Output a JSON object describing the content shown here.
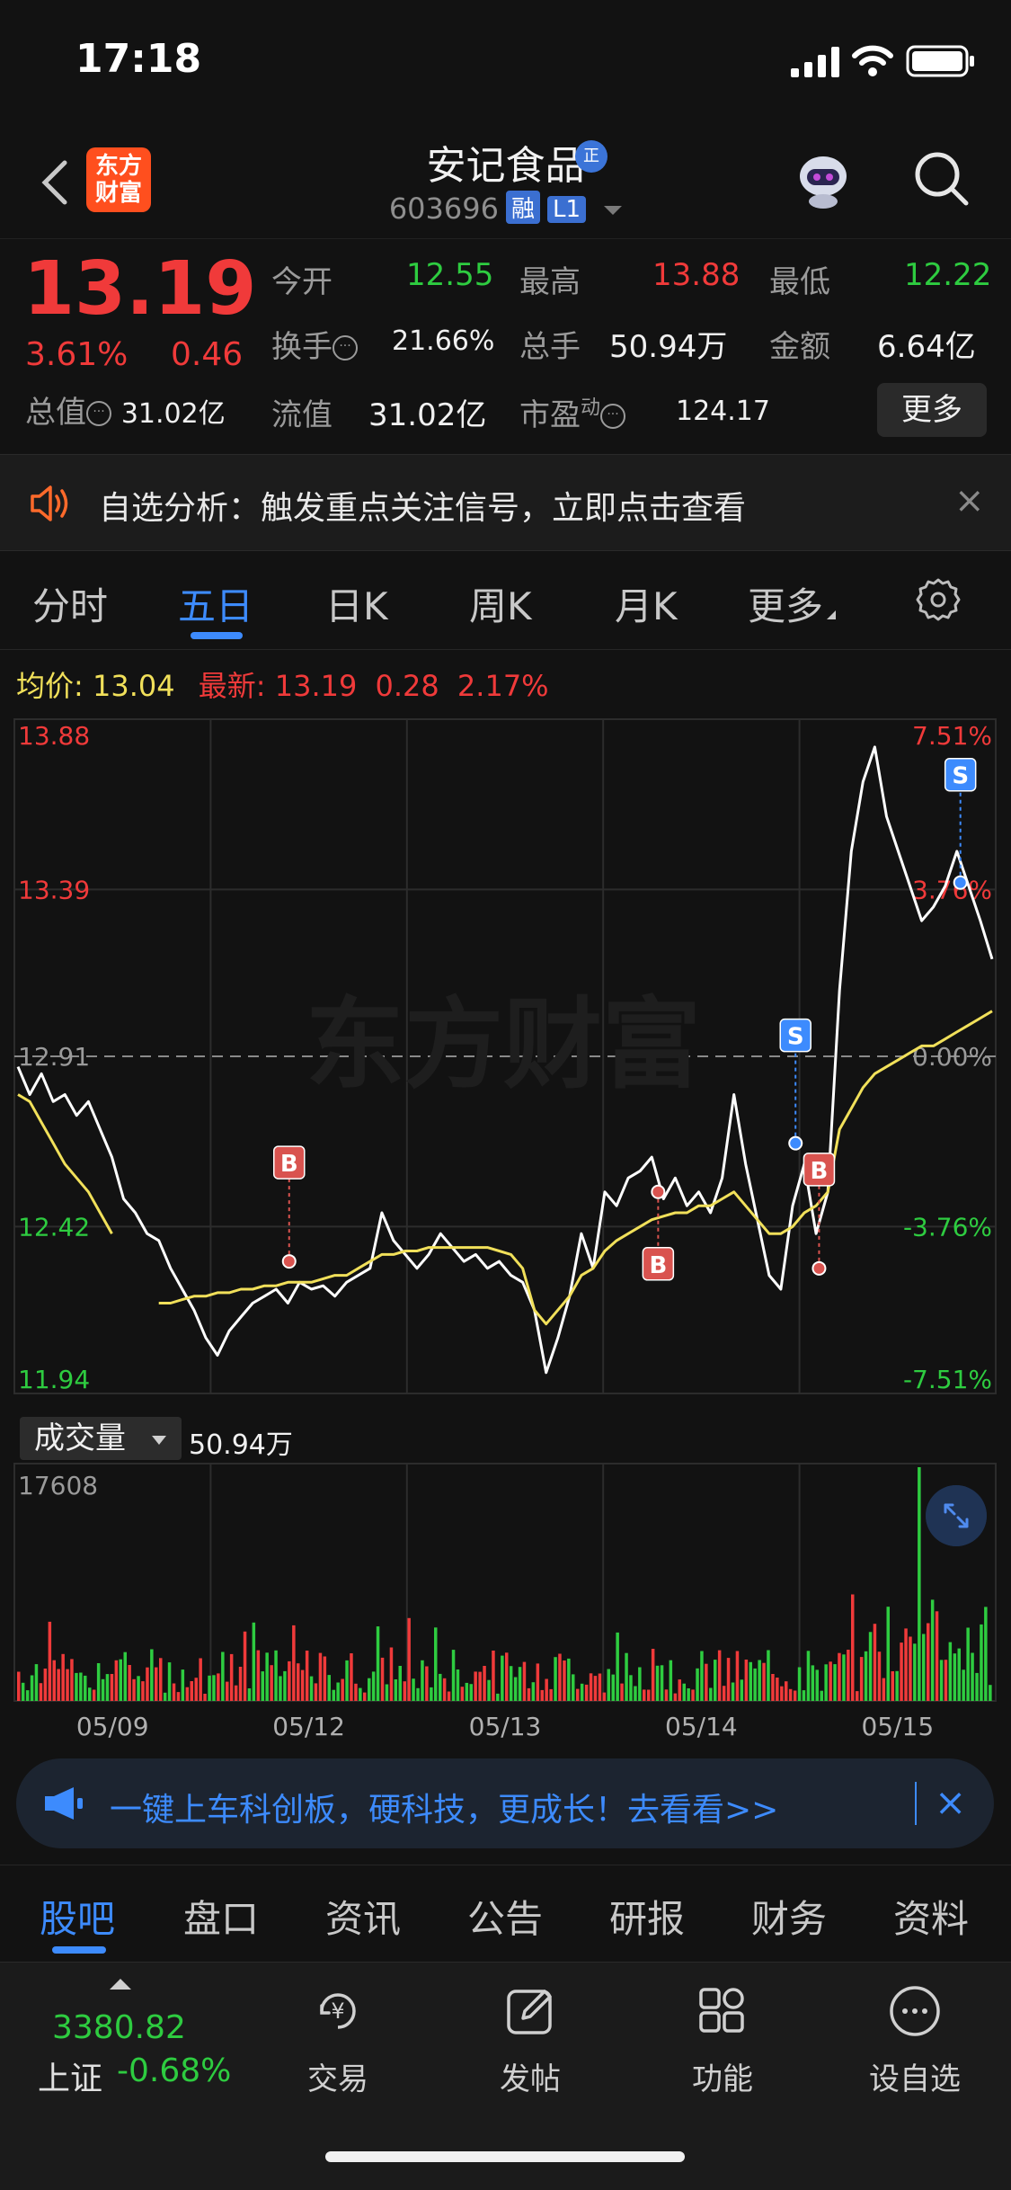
{
  "status_bar": {
    "time": "17:18"
  },
  "header": {
    "logo_text": "东方财富",
    "stock_name": "安记食品",
    "verified_badge": "正",
    "stock_code": "603696",
    "tags": [
      "融",
      "L1"
    ]
  },
  "quote": {
    "last_price": "13.19",
    "pct_change": "3.61%",
    "abs_change": "0.46",
    "open_label": "今开",
    "open_value": "12.55",
    "high_label": "最高",
    "high_value": "13.88",
    "low_label": "最低",
    "low_value": "12.22",
    "turnover_rate_label": "换手",
    "turnover_rate_value": "21.66%",
    "volume_label": "总手",
    "volume_value": "50.94万",
    "amount_label": "金额",
    "amount_value": "6.64亿",
    "total_mv_label": "总值",
    "total_mv_value": "31.02亿",
    "float_mv_label": "流值",
    "float_mv_value": "31.02亿",
    "pe_label": "市盈",
    "pe_superscript": "动",
    "pe_value": "124.17",
    "more_button": "更多"
  },
  "banner": {
    "text": "自选分析：触发重点关注信号，立即点击查看",
    "close": "×"
  },
  "period_tabs": [
    {
      "label": "分时",
      "active": false
    },
    {
      "label": "五日",
      "active": true
    },
    {
      "label": "日K",
      "active": false
    },
    {
      "label": "周K",
      "active": false
    },
    {
      "label": "月K",
      "active": false
    },
    {
      "label": "更多",
      "active": false
    }
  ],
  "indicator": {
    "avg_label": "均价:",
    "avg_value": "13.04",
    "latest_label": "最新:",
    "latest_value": "13.19",
    "latest_change": "0.28",
    "latest_pct": "2.17%"
  },
  "chart_data": {
    "type": "line",
    "y_left_labels": [
      "13.88",
      "13.39",
      "12.91",
      "12.42",
      "11.94"
    ],
    "y_right_labels": [
      "7.51%",
      "3.76%",
      "0.00%",
      "-3.76%",
      "-7.51%"
    ],
    "ylim": [
      11.94,
      13.88
    ],
    "ref_price": 12.91,
    "x_labels": [
      "05/09",
      "05/12",
      "05/13",
      "05/14",
      "05/15"
    ],
    "watermark": "东方财富",
    "series": [
      {
        "values": [
          12.88,
          12.8,
          12.86,
          12.78,
          12.8,
          12.74,
          12.78,
          12.7,
          12.62,
          12.5,
          12.46,
          12.4,
          12.38,
          12.3,
          12.24,
          12.18,
          12.1,
          12.05,
          12.12,
          12.16,
          12.2,
          12.22,
          12.24,
          12.2,
          12.26,
          12.24,
          12.25,
          12.22,
          12.26,
          12.28,
          12.3,
          12.46,
          12.38,
          12.34,
          12.3,
          12.34,
          12.4,
          12.36,
          12.32,
          12.34,
          12.3,
          12.32,
          12.28,
          12.26,
          12.18,
          12.0,
          12.1,
          12.22,
          12.4,
          12.3,
          12.52,
          12.48,
          12.56,
          12.58,
          12.62,
          12.5,
          12.56,
          12.48,
          12.52,
          12.46,
          12.56,
          12.8,
          12.6,
          12.44,
          12.28,
          12.24,
          12.48,
          12.6,
          12.4,
          12.52,
          13.1,
          13.5,
          13.7,
          13.8,
          13.6,
          13.5,
          13.4,
          13.3,
          13.34,
          13.4,
          13.5,
          13.4,
          13.3,
          13.19
        ]
      },
      {
        "values": [
          12.8,
          12.78,
          12.72,
          12.66,
          12.6,
          12.56,
          12.52,
          12.46,
          12.4,
          null,
          null,
          null,
          12.2,
          12.2,
          12.21,
          12.22,
          12.22,
          12.23,
          12.23,
          12.24,
          12.24,
          12.25,
          12.25,
          12.26,
          12.26,
          12.26,
          12.27,
          12.28,
          12.28,
          12.3,
          12.32,
          12.34,
          12.34,
          12.35,
          12.35,
          12.36,
          12.36,
          12.36,
          12.36,
          12.36,
          12.36,
          12.35,
          12.34,
          12.3,
          12.18,
          12.14,
          12.18,
          12.22,
          12.28,
          12.3,
          12.35,
          12.38,
          12.4,
          12.42,
          12.44,
          12.45,
          12.46,
          12.46,
          12.48,
          12.48,
          12.5,
          12.52,
          12.48,
          12.44,
          12.4,
          12.4,
          12.42,
          12.46,
          12.48,
          12.52,
          12.7,
          12.76,
          12.82,
          12.86,
          12.88,
          12.9,
          12.92,
          12.94,
          12.94,
          12.96,
          12.98,
          13.0,
          13.02,
          13.04
        ]
      }
    ],
    "trade_markers": [
      {
        "type": "B",
        "day": 1,
        "price": 12.32
      },
      {
        "type": "B",
        "day": 3,
        "price": 12.52
      },
      {
        "type": "S",
        "day": 3,
        "price": 12.66
      },
      {
        "type": "B",
        "day": 4,
        "price": 12.3
      },
      {
        "type": "S",
        "day": 4,
        "price": 13.41
      }
    ]
  },
  "volume": {
    "selector_label": "成交量",
    "total": "50.94万",
    "max_label": "17608"
  },
  "promo": {
    "text": "一键上车科创板，硬科技，更成长！去看看>>",
    "close": "×"
  },
  "section_tabs": [
    "股吧",
    "盘口",
    "资讯",
    "公告",
    "研报",
    "财务",
    "资料"
  ],
  "bottom_nav": {
    "index_value": "3380.82",
    "index_name": "上证",
    "index_pct": "-0.68%",
    "items": [
      {
        "label": "交易",
        "icon": "trade-icon"
      },
      {
        "label": "发帖",
        "icon": "post-icon"
      },
      {
        "label": "功能",
        "icon": "function-icon"
      },
      {
        "label": "设自选",
        "icon": "add-watchlist-icon"
      }
    ]
  },
  "colors": {
    "up": "#f03a3a",
    "down": "#2ecc40",
    "accent": "#3d8bfd",
    "avg_line": "#f1e05a"
  }
}
